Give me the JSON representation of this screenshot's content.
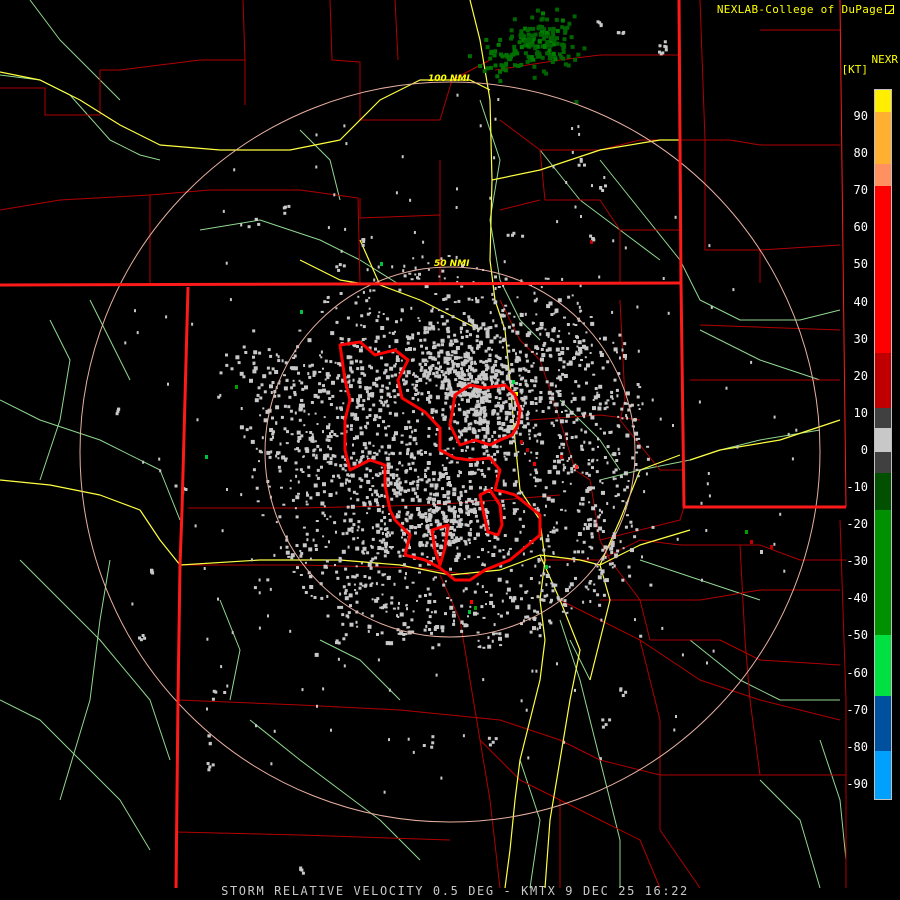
{
  "header": {
    "credit": "NEXLAB-College of DuPage",
    "credit_icon": "external-link-icon",
    "product": "NEXR",
    "unit": "[KT]"
  },
  "footer": {
    "caption": "STORM RELATIVE VELOCITY 0.5 DEG - KMTX 9 DEC 25 16:22"
  },
  "range_rings": {
    "inner_label": "50 NMI",
    "outer_label": "100 NMI"
  },
  "legend": {
    "ticks": [
      "90",
      "80",
      "70",
      "60",
      "50",
      "40",
      "30",
      "20",
      "10",
      "0",
      "-10",
      "-20",
      "-30",
      "-40",
      "-50",
      "-60",
      "-70",
      "-80",
      "-90"
    ],
    "segments": [
      {
        "color": "#ffee00"
      },
      {
        "color": "#ffb030"
      },
      {
        "color": "#ff9060"
      },
      {
        "color": "#ff0000"
      },
      {
        "color": "#c00000"
      },
      {
        "color": "#800000"
      },
      {
        "color": "#404040"
      },
      {
        "color": "#c8c8c8"
      },
      {
        "color": "#404040"
      },
      {
        "color": "#005000"
      },
      {
        "color": "#009000"
      },
      {
        "color": "#00e040"
      },
      {
        "color": "#0050a0"
      },
      {
        "color": "#00a0ff"
      }
    ]
  },
  "colors": {
    "state_border": "#ff1a1a",
    "county_line": "#b00000",
    "highway": "#ffff40",
    "river": "#90d890",
    "range_ring": "#e8b0a0",
    "warning_polygon": "#ff0000",
    "echo_gray": "#c8c8c8"
  }
}
